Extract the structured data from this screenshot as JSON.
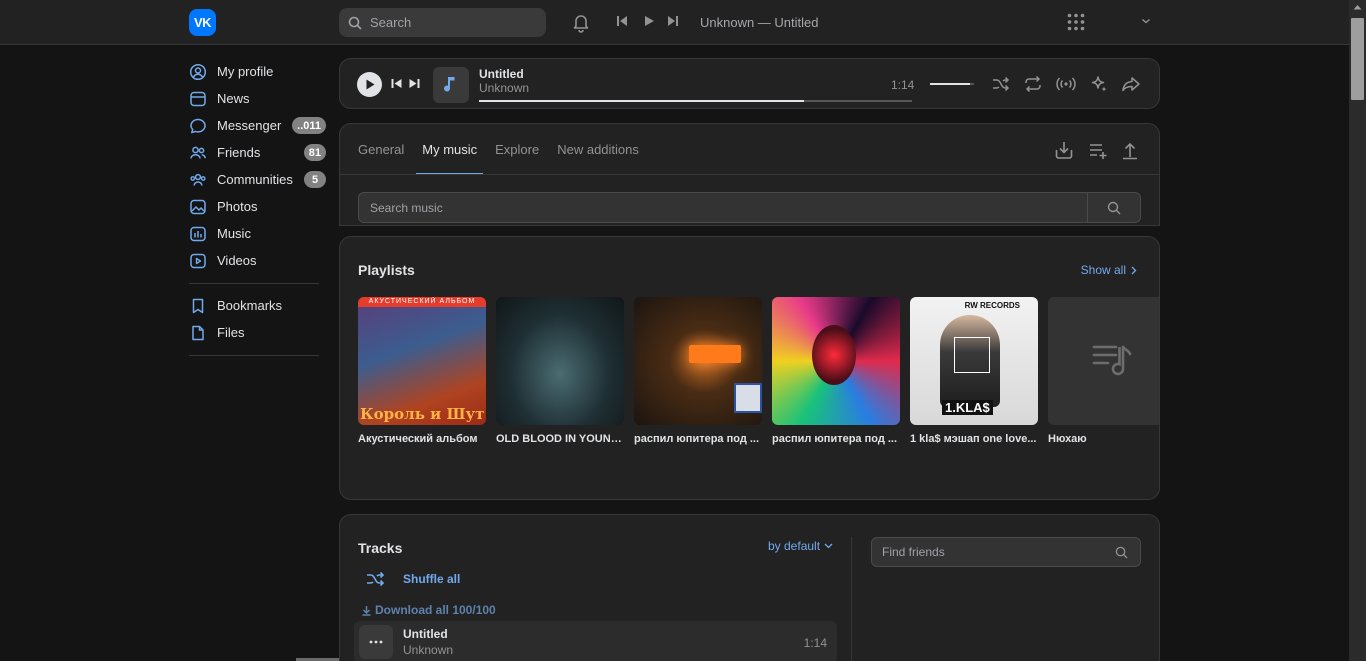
{
  "header": {
    "logo_text": "VK",
    "search_placeholder": "Search",
    "now_playing": "Unknown — Untitled"
  },
  "sidebar": {
    "items": [
      {
        "label": "My profile",
        "icon": "user-circle-icon"
      },
      {
        "label": "News",
        "icon": "news-icon"
      },
      {
        "label": "Messenger",
        "icon": "message-icon",
        "badge": "..011"
      },
      {
        "label": "Friends",
        "icon": "friends-icon",
        "badge": "81"
      },
      {
        "label": "Communities",
        "icon": "communities-icon",
        "badge": "5"
      },
      {
        "label": "Photos",
        "icon": "photos-icon"
      },
      {
        "label": "Music",
        "icon": "music-icon"
      },
      {
        "label": "Videos",
        "icon": "videos-icon"
      }
    ],
    "secondary": [
      {
        "label": "Bookmarks",
        "icon": "bookmark-icon"
      },
      {
        "label": "Files",
        "icon": "file-icon"
      }
    ]
  },
  "player": {
    "title": "Untitled",
    "artist": "Unknown",
    "time": "1:14",
    "progress": 0.75,
    "volume": 0.9
  },
  "music": {
    "tabs": [
      "General",
      "My music",
      "Explore",
      "New additions"
    ],
    "active_tab": "My music",
    "search_placeholder": "Search music"
  },
  "playlists": {
    "title": "Playlists",
    "show_all": "Show all",
    "items": [
      {
        "name": "Акустический альбом",
        "banner": "АКУСТИЧЕСКИЙ АЛЬБОМ",
        "cover_text": "Король и Шут"
      },
      {
        "name": "OLD BLOOD IN YOUNG..."
      },
      {
        "name": "распил юпитера под ..."
      },
      {
        "name": "распил юпитера под ..."
      },
      {
        "name": "1 kla$ мэшап one love...",
        "cover_text": "1.KLA$",
        "cover_logo": "RW RECORDS"
      },
      {
        "name": "Нюхаю"
      }
    ]
  },
  "tracks": {
    "title": "Tracks",
    "sort": "by default",
    "shuffle": "Shuffle all",
    "download": "Download all 100/100",
    "items": [
      {
        "title": "Untitled",
        "artist": "Unknown",
        "duration": "1:14"
      }
    ],
    "find_friends_placeholder": "Find friends"
  }
}
